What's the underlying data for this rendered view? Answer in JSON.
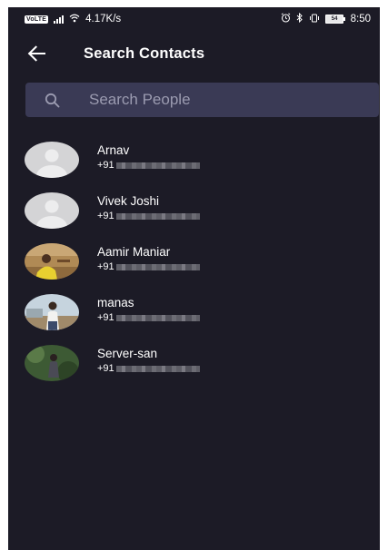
{
  "status_bar": {
    "volte": "VoLTE",
    "network_speed": "4.17K/s",
    "battery_level": "54",
    "time": "8:50",
    "icons": [
      "signal-icon",
      "wifi-icon",
      "alarm-icon",
      "bluetooth-icon",
      "vibrate-icon",
      "battery-icon"
    ]
  },
  "header": {
    "title": "Search Contacts",
    "back_icon": "arrow-left-icon"
  },
  "search": {
    "placeholder": "Search People",
    "value": "",
    "icon": "search-icon"
  },
  "contacts": [
    {
      "name": "Arnav",
      "phone_prefix": "+91",
      "avatar": "default-avatar-icon"
    },
    {
      "name": "Vivek Joshi",
      "phone_prefix": "+91",
      "avatar": "default-avatar-icon"
    },
    {
      "name": "Aamir Maniar",
      "phone_prefix": "+91",
      "avatar": "photo-avatar"
    },
    {
      "name": "manas",
      "phone_prefix": "+91",
      "avatar": "photo-avatar"
    },
    {
      "name": "Server-san",
      "phone_prefix": "+91",
      "avatar": "photo-avatar"
    }
  ],
  "colors": {
    "background": "#1c1b26",
    "search_background": "#3a3a55",
    "placeholder": "#9b9bb0",
    "text": "#ffffff"
  }
}
